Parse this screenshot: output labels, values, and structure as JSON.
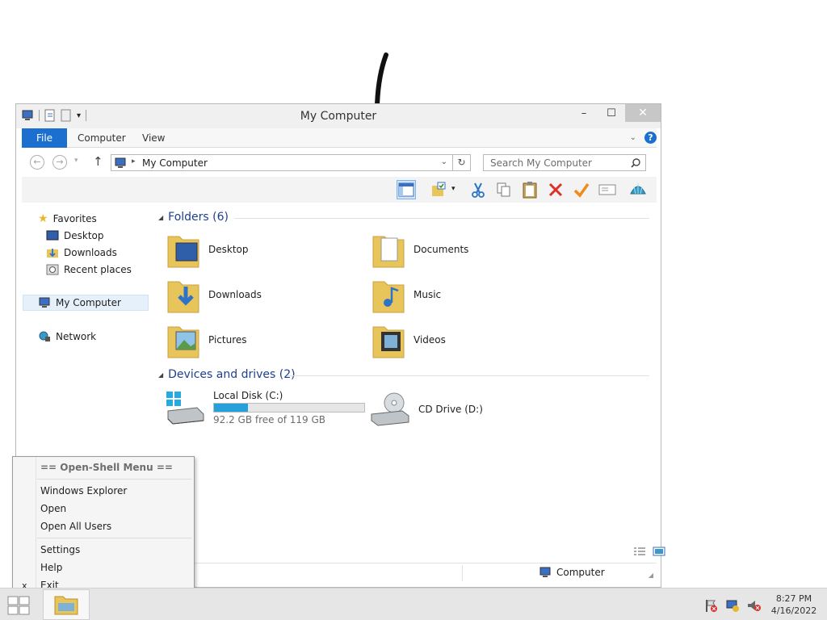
{
  "window": {
    "title": "My Computer",
    "controls": {
      "minimize": "–",
      "maximize": "☐",
      "close": "✕"
    }
  },
  "ribbon": {
    "tabs": [
      {
        "label": "File"
      },
      {
        "label": "Computer"
      },
      {
        "label": "View"
      }
    ],
    "help": "?"
  },
  "navigation": {
    "back": "←",
    "forward": "→",
    "up": "↑",
    "address": "My Computer",
    "refresh": "↻",
    "search_placeholder": "Search My Computer"
  },
  "sidebar": {
    "favorites": "Favorites",
    "items": [
      "Desktop",
      "Downloads",
      "Recent places"
    ],
    "my_computer": "My Computer",
    "network": "Network"
  },
  "folders": {
    "header": "Folders (6)",
    "items": [
      "Desktop",
      "Documents",
      "Downloads",
      "Music",
      "Pictures",
      "Videos"
    ]
  },
  "drives": {
    "header": "Devices and drives (2)",
    "items": [
      {
        "name": "Local Disk (C:)",
        "detail": "92.2 GB free of 119 GB",
        "used_percent": 22.5
      },
      {
        "name": "CD Drive (D:)"
      }
    ]
  },
  "statusbar": {
    "location": "Computer"
  },
  "context_menu": {
    "header": "== Open-Shell Menu ==",
    "items": [
      "Windows Explorer",
      "Open",
      "Open All Users",
      "Settings",
      "Help",
      "Exit"
    ],
    "exit_mark": "x"
  },
  "taskbar": {
    "time": "8:27 PM",
    "date": "4/16/2022"
  },
  "colors": {
    "accent": "#1a6fcf",
    "drive_fill": "#26a0da",
    "folder": "#e8c55a"
  }
}
